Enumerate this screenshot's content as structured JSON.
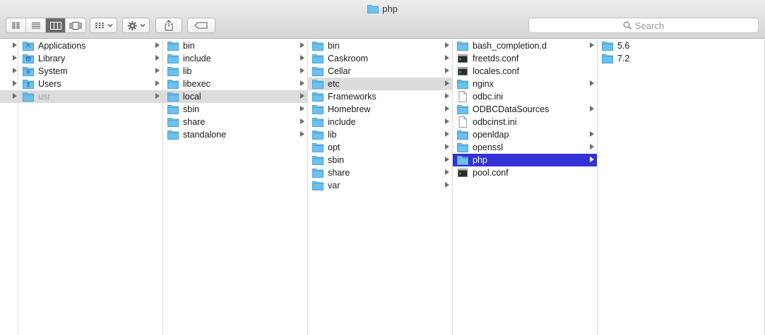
{
  "window": {
    "title": "php"
  },
  "toolbar": {
    "view_modes": [
      {
        "name": "icon-view",
        "icon": "grid-icon",
        "active": false
      },
      {
        "name": "list-view",
        "icon": "list-icon",
        "active": false
      },
      {
        "name": "column-view",
        "icon": "columns-icon",
        "active": true
      },
      {
        "name": "gallery-view",
        "icon": "gallery-icon",
        "active": false
      }
    ],
    "search": {
      "placeholder": "Search"
    }
  },
  "columns": [
    {
      "items": [
        {
          "label": "Applications",
          "icon": "applications-folder-icon",
          "arrow": true
        },
        {
          "label": "Library",
          "icon": "library-folder-icon",
          "arrow": true
        },
        {
          "label": "System",
          "icon": "system-folder-icon",
          "arrow": true
        },
        {
          "label": "Users",
          "icon": "users-folder-icon",
          "arrow": true
        },
        {
          "label": "usr",
          "icon": "folder-icon",
          "arrow": true,
          "selected": "gray",
          "dim": true
        }
      ]
    },
    {
      "items": [
        {
          "label": "bin",
          "icon": "folder-icon",
          "arrow": true
        },
        {
          "label": "include",
          "icon": "folder-icon",
          "arrow": true
        },
        {
          "label": "lib",
          "icon": "folder-icon",
          "arrow": true
        },
        {
          "label": "libexec",
          "icon": "folder-icon",
          "arrow": true
        },
        {
          "label": "local",
          "icon": "folder-icon",
          "arrow": true,
          "selected": "gray"
        },
        {
          "label": "sbin",
          "icon": "folder-icon",
          "arrow": true
        },
        {
          "label": "share",
          "icon": "folder-icon",
          "arrow": true
        },
        {
          "label": "standalone",
          "icon": "folder-icon",
          "arrow": true
        }
      ]
    },
    {
      "items": [
        {
          "label": "bin",
          "icon": "folder-icon",
          "arrow": true
        },
        {
          "label": "Caskroom",
          "icon": "folder-icon",
          "arrow": true
        },
        {
          "label": "Cellar",
          "icon": "folder-icon",
          "arrow": true
        },
        {
          "label": "etc",
          "icon": "folder-icon",
          "arrow": true,
          "selected": "gray"
        },
        {
          "label": "Frameworks",
          "icon": "folder-icon",
          "arrow": true
        },
        {
          "label": "Homebrew",
          "icon": "folder-icon",
          "arrow": true
        },
        {
          "label": "include",
          "icon": "folder-icon",
          "arrow": true
        },
        {
          "label": "lib",
          "icon": "folder-icon",
          "arrow": true
        },
        {
          "label": "opt",
          "icon": "folder-icon",
          "arrow": true
        },
        {
          "label": "sbin",
          "icon": "folder-icon",
          "arrow": true
        },
        {
          "label": "share",
          "icon": "folder-icon",
          "arrow": true
        },
        {
          "label": "var",
          "icon": "folder-icon",
          "arrow": true
        }
      ]
    },
    {
      "items": [
        {
          "label": "bash_completion.d",
          "icon": "folder-icon",
          "arrow": true
        },
        {
          "label": "freetds.conf",
          "icon": "terminal-file-icon",
          "arrow": false
        },
        {
          "label": "locales.conf",
          "icon": "terminal-file-icon",
          "arrow": false
        },
        {
          "label": "nginx",
          "icon": "folder-icon",
          "arrow": true
        },
        {
          "label": "odbc.ini",
          "icon": "document-icon",
          "arrow": false
        },
        {
          "label": "ODBCDataSources",
          "icon": "folder-icon",
          "arrow": true
        },
        {
          "label": "odbcinst.ini",
          "icon": "document-icon",
          "arrow": false
        },
        {
          "label": "openldap",
          "icon": "folder-icon",
          "arrow": true
        },
        {
          "label": "openssl",
          "icon": "folder-icon",
          "arrow": true
        },
        {
          "label": "php",
          "icon": "folder-icon",
          "arrow": true,
          "selected": "blue"
        },
        {
          "label": "pool.conf",
          "icon": "terminal-file-icon",
          "arrow": false
        }
      ]
    },
    {
      "items": [
        {
          "label": "5.6",
          "icon": "folder-icon",
          "arrow": false
        },
        {
          "label": "7.2",
          "icon": "folder-icon",
          "arrow": false
        }
      ]
    }
  ],
  "colors": {
    "selection_active": "#3432d6",
    "selection_inactive": "#dcdcdc",
    "folder": "#6cc1ef"
  }
}
